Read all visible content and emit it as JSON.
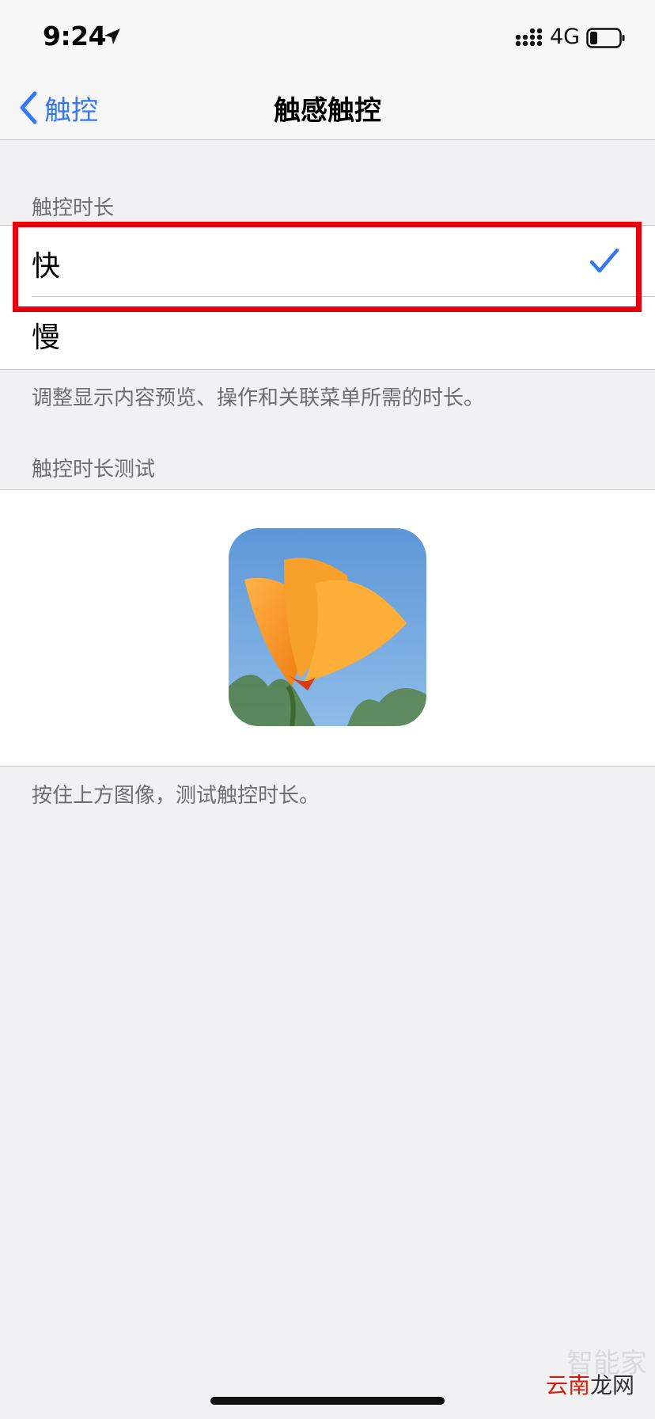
{
  "status_bar": {
    "time": "9:24",
    "network": "4G",
    "icons": [
      "location-arrow-icon",
      "signal-bars-icon",
      "battery-icon"
    ]
  },
  "nav": {
    "back_label": "触控",
    "title": "触感触控"
  },
  "touch_duration": {
    "header": "触控时长",
    "options": [
      {
        "label": "快",
        "selected": true
      },
      {
        "label": "慢",
        "selected": false
      }
    ],
    "footer": "调整显示内容预览、操作和关联菜单所需的时长。"
  },
  "duration_test": {
    "header": "触控时长测试",
    "footer": "按住上方图像，测试触控时长。"
  },
  "watermark": {
    "part1": "云南",
    "part2": "龙网",
    "faint": "智能家"
  },
  "colors": {
    "accent": "#3478f6",
    "highlight_box": "#e8000d",
    "background": "#f1f1f4"
  }
}
